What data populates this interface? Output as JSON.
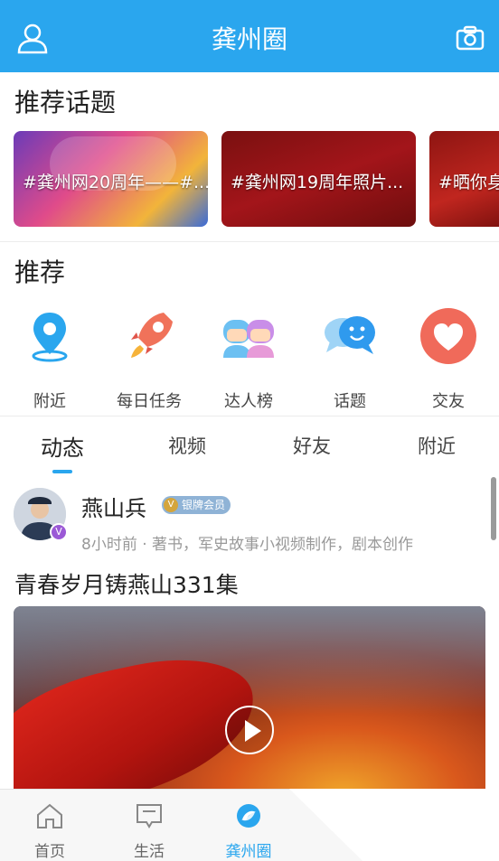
{
  "header": {
    "title": "龚州圈",
    "user_icon": "user-icon",
    "camera_icon": "camera-icon",
    "bg_color": "#2aa6ee"
  },
  "topics_section": {
    "title": "推荐话题",
    "cards": [
      {
        "label": "#龚州网20周年——#..."
      },
      {
        "label": "#龚州网19周年照片..."
      },
      {
        "label": "#晒你身"
      }
    ]
  },
  "recommend_section": {
    "title": "推荐",
    "items": [
      {
        "label": "附近",
        "icon": "location-pin-icon"
      },
      {
        "label": "每日任务",
        "icon": "rocket-icon"
      },
      {
        "label": "达人榜",
        "icon": "people-icon"
      },
      {
        "label": "话题",
        "icon": "chat-bubbles-icon"
      },
      {
        "label": "交友",
        "icon": "heart-icon"
      }
    ]
  },
  "feed_tabs": [
    {
      "label": "动态",
      "active": true
    },
    {
      "label": "视频",
      "active": false
    },
    {
      "label": "好友",
      "active": false
    },
    {
      "label": "附近",
      "active": false
    }
  ],
  "post": {
    "author": "燕山兵",
    "member_badge": "银牌会员",
    "meta": "8小时前 · 著书，军史故事小视频制作，剧本创作",
    "title": "青春岁月铸燕山331集",
    "verified_badge": "V"
  },
  "bottom_nav": [
    {
      "label": "首页",
      "icon": "home-icon",
      "active": false
    },
    {
      "label": "生活",
      "icon": "message-square-icon",
      "active": false
    },
    {
      "label": "龚州圈",
      "icon": "circle-logo-icon",
      "active": true
    }
  ]
}
